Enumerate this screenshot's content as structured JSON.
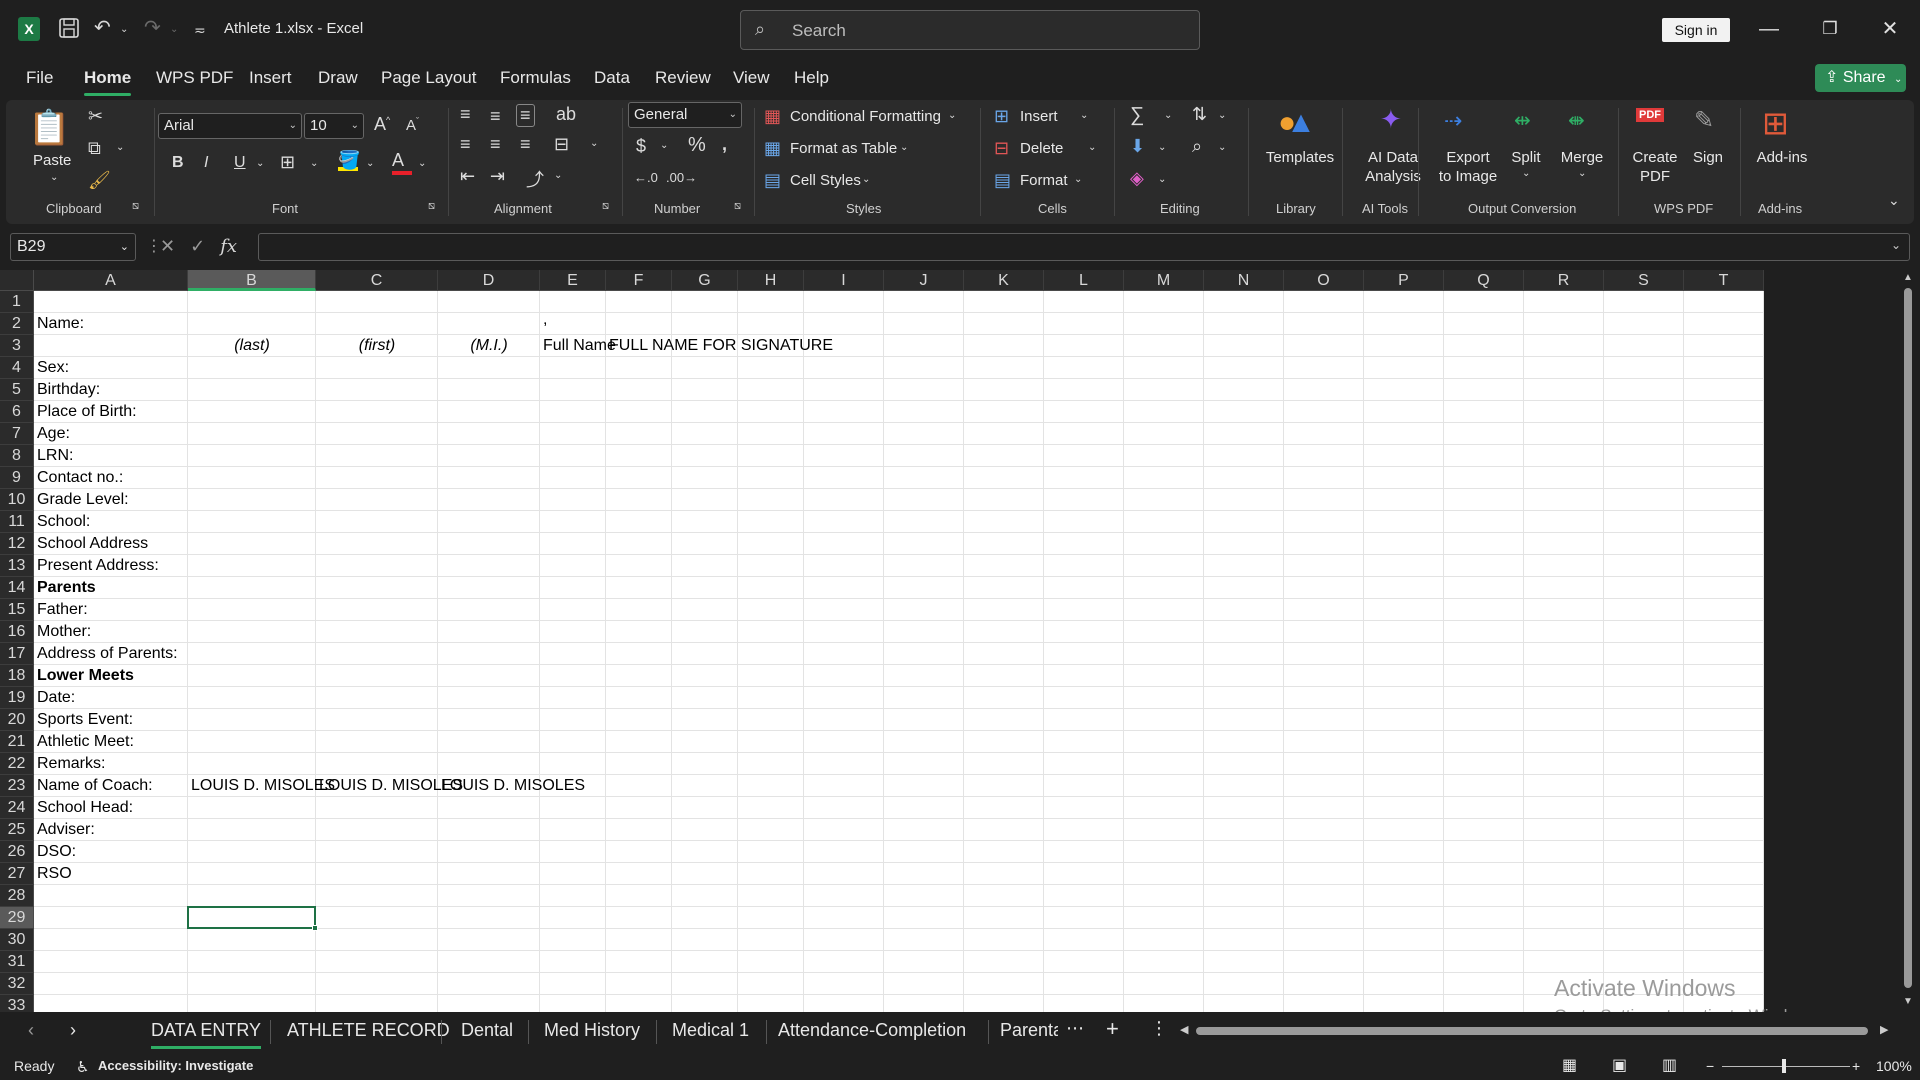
{
  "titlebar": {
    "doc_title": "Athlete 1.xlsx  -  Excel",
    "search_placeholder": "Search",
    "signin_label": "Sign in"
  },
  "menu": {
    "tabs": [
      "File",
      "Home",
      "WPS PDF",
      "Insert",
      "Draw",
      "Page Layout",
      "Formulas",
      "Data",
      "Review",
      "View",
      "Help"
    ],
    "active": "Home",
    "share_label": "Share"
  },
  "ribbon": {
    "clipboard": {
      "paste_label": "Paste",
      "group_label": "Clipboard"
    },
    "font": {
      "font_name": "Arial",
      "font_size": "10",
      "group_label": "Font"
    },
    "alignment": {
      "group_label": "Alignment"
    },
    "number": {
      "format": "General",
      "group_label": "Number"
    },
    "styles": {
      "conditional_formatting": "Conditional Formatting",
      "format_as_table": "Format as Table",
      "cell_styles": "Cell Styles",
      "group_label": "Styles"
    },
    "cells": {
      "insert": "Insert",
      "delete": "Delete",
      "format": "Format",
      "group_label": "Cells"
    },
    "editing": {
      "group_label": "Editing"
    },
    "library": {
      "templates": "Templates",
      "group_label": "Library"
    },
    "ai_tools": {
      "ai_data_analysis_line1": "AI Data",
      "ai_data_analysis_line2": "Analysis",
      "group_label": "AI Tools"
    },
    "output_conversion": {
      "export_line1": "Export",
      "export_line2": "to Image",
      "split": "Split",
      "merge": "Merge",
      "group_label": "Output Conversion"
    },
    "wps_pdf": {
      "create_line1": "Create",
      "create_line2": "PDF",
      "sign": "Sign",
      "group_label": "WPS PDF"
    },
    "addins": {
      "addins": "Add-ins",
      "group_label": "Add-ins"
    }
  },
  "formula_bar": {
    "name_box": "B29",
    "formula": ""
  },
  "grid": {
    "columns": [
      "A",
      "B",
      "C",
      "D",
      "E",
      "F",
      "G",
      "H",
      "I",
      "J",
      "K",
      "L",
      "M",
      "N",
      "O",
      "P",
      "Q",
      "R",
      "S",
      "T"
    ],
    "rows": [
      "1",
      "2",
      "3",
      "4",
      "5",
      "6",
      "7",
      "8",
      "9",
      "10",
      "11",
      "12",
      "13",
      "14",
      "15",
      "16",
      "17",
      "18",
      "19",
      "20",
      "21",
      "22",
      "23",
      "24",
      "25",
      "26",
      "27",
      "28",
      "29",
      "30",
      "31",
      "32",
      "33"
    ],
    "selected_column": "B",
    "selected_row": "29",
    "cells": {
      "A2": "Name:",
      "E2": ",",
      "B3": "(last)",
      "C3": "(first)",
      "D3": "(M.I.)",
      "E3": "Full Name",
      "F3": "FULL NAME FOR SIGNATURE",
      "A4": "Sex:",
      "A5": "Birthday:",
      "A6": "Place of Birth:",
      "A7": "Age:",
      "A8": "LRN:",
      "A9": "Contact no.:",
      "A10": "Grade Level:",
      "A11": "School:",
      "A12": "School Address",
      "A13": "Present Address:",
      "A14": "Parents",
      "A15": "Father:",
      "A16": "Mother:",
      "A17": "Address of Parents:",
      "A18": "Lower Meets",
      "A19": "Date:",
      "A20": "Sports Event:",
      "A21": "Athletic Meet:",
      "A22": "Remarks:",
      "A23": "Name of Coach:",
      "B23": "LOUIS D. MISOLES",
      "C23": "LOUIS D. MISOLES",
      "D23": "LOUIS D. MISOLES",
      "A24": "School Head:",
      "A25": "Adviser:",
      "A26": "DSO:",
      "A27": "RSO"
    },
    "bold_cells": [
      "A14",
      "A18"
    ],
    "italic_cells": [
      "B3",
      "C3",
      "D3"
    ]
  },
  "sheets": {
    "tabs": [
      "DATA ENTRY",
      "ATHLETE RECORD",
      "Dental",
      "Med History",
      "Medical 1",
      "Attendance-Completion",
      "Parenta"
    ],
    "active": "DATA ENTRY"
  },
  "watermark": {
    "line1": "Activate Windows",
    "line2": "Go to Settings to activate Windows."
  },
  "status": {
    "ready": "Ready",
    "accessibility": "Accessibility: Investigate",
    "zoom": "100%"
  }
}
